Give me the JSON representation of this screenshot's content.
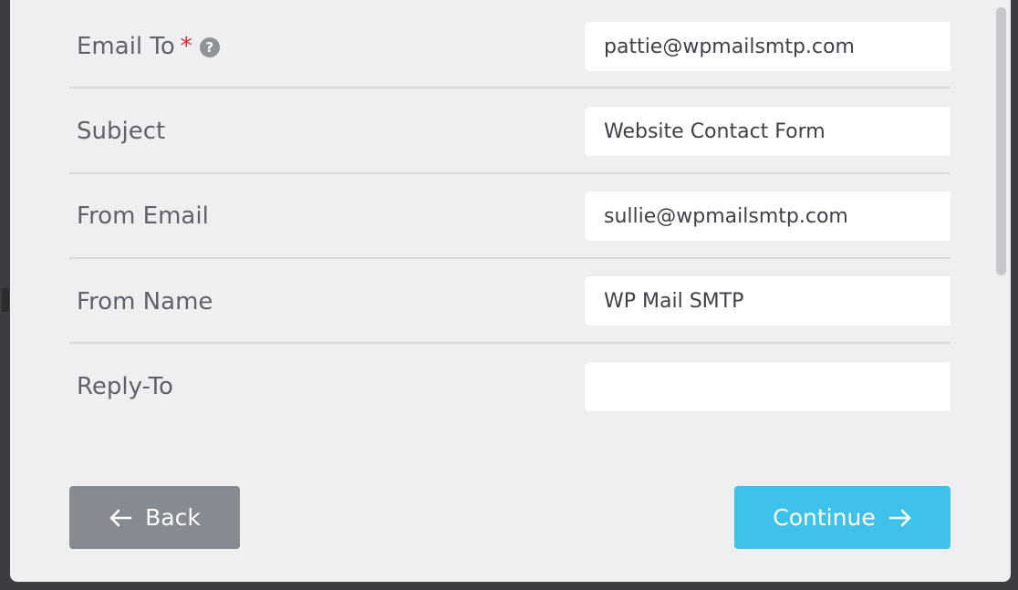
{
  "form": {
    "fields": [
      {
        "label": "Email To",
        "required_mark": "*",
        "help_icon": "help-icon",
        "value": "pattie@wpmailsmtp.com",
        "placeholder": ""
      },
      {
        "label": "Subject",
        "value": "Website Contact Form",
        "placeholder": ""
      },
      {
        "label": "From Email",
        "value": "sullie@wpmailsmtp.com",
        "placeholder": ""
      },
      {
        "label": "From Name",
        "value": "WP Mail SMTP",
        "placeholder": ""
      },
      {
        "label": "Reply-To",
        "value": "",
        "placeholder": ""
      }
    ]
  },
  "buttons": {
    "back_label": "Back",
    "back_icon": "arrow-left-icon",
    "continue_label": "Continue",
    "continue_icon": "arrow-right-icon"
  },
  "colors": {
    "modal_background": "#efeff1",
    "back_button": "#858b90",
    "continue_button": "#3fc2ea",
    "required_mark": "#e0262b",
    "label_text": "#5f6268"
  }
}
